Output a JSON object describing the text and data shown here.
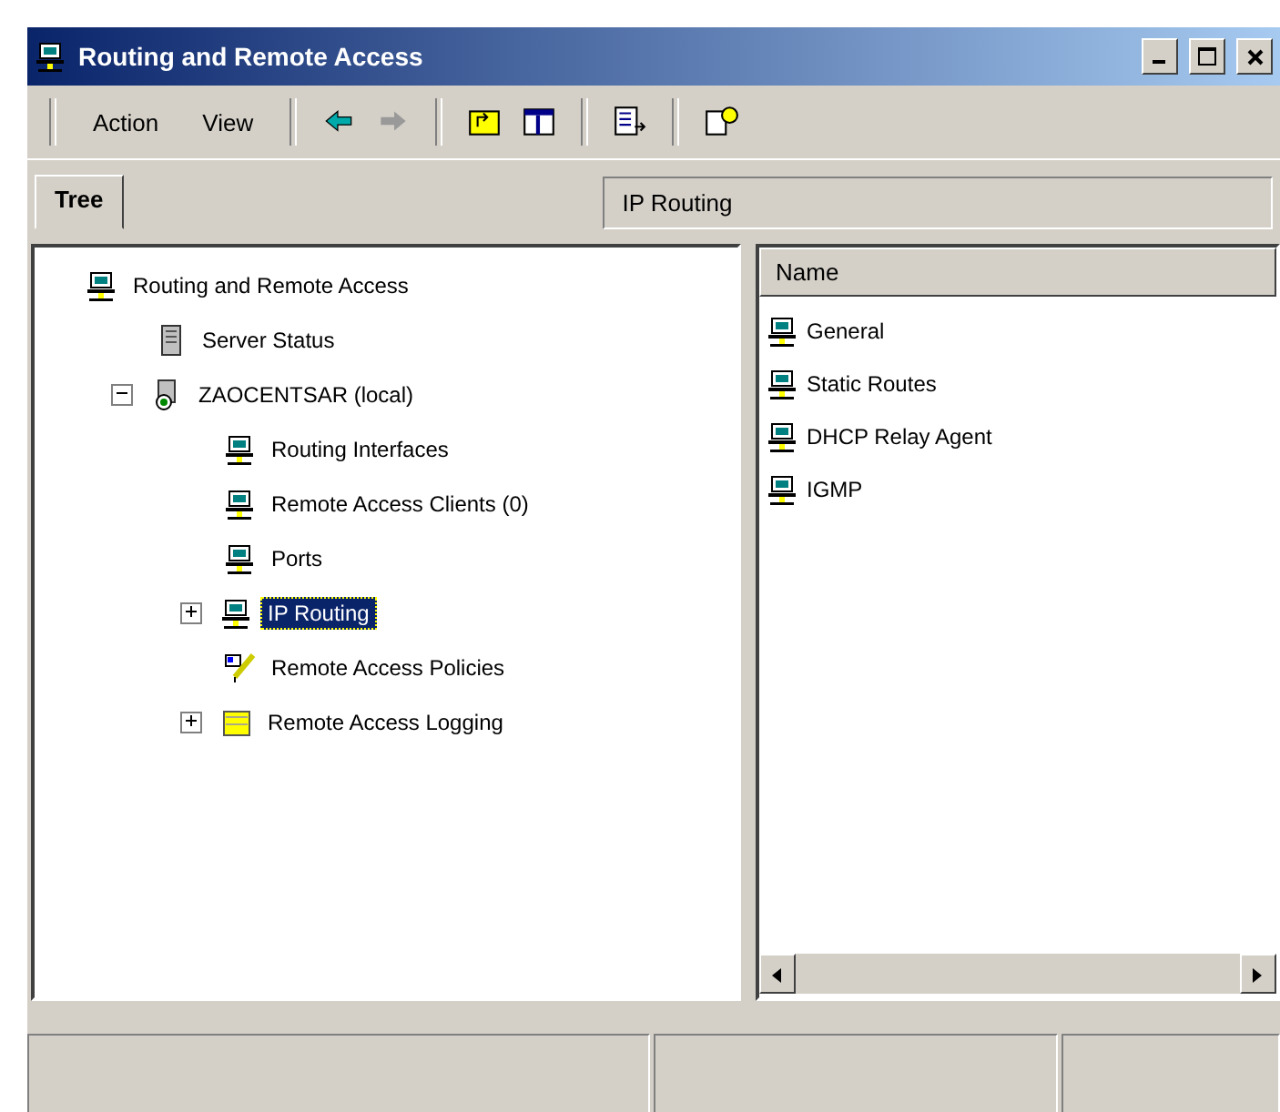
{
  "window": {
    "title": "Routing and Remote Access"
  },
  "menu": [
    {
      "label": "Action"
    },
    {
      "label": "View"
    }
  ],
  "toolbar": [
    {
      "kind": "back",
      "disabled": false
    },
    {
      "kind": "forward",
      "disabled": true
    },
    {
      "kind": "up"
    },
    {
      "kind": "show-tree"
    },
    {
      "kind": "export"
    },
    {
      "kind": "help"
    }
  ],
  "tabs": [
    {
      "label": "Tree",
      "selected": true
    }
  ],
  "tree": [
    {
      "label": "Routing and Remote Access",
      "kind": "computer",
      "selected": false,
      "children": [
        {
          "label": "Server Status",
          "kind": "server",
          "selected": false
        },
        {
          "label": "ZAOCENTSAR (local)",
          "kind": "local",
          "selected": false,
          "expanded": true,
          "children": [
            {
              "label": "Routing Interfaces",
              "kind": "computer",
              "selected": false
            },
            {
              "label": "Remote Access Clients (0)",
              "kind": "computer",
              "selected": false
            },
            {
              "label": "Ports",
              "kind": "computer",
              "selected": false
            },
            {
              "label": "IP Routing",
              "kind": "computer",
              "selected": true,
              "expanded": false
            },
            {
              "label": "Remote Access Policies",
              "kind": "policy",
              "selected": false
            },
            {
              "label": "Remote Access Logging",
              "kind": "log",
              "selected": false,
              "expanded": false
            }
          ]
        }
      ]
    }
  ],
  "detail": {
    "title": "IP Routing",
    "columns": [
      "Name"
    ],
    "rows": [
      {
        "name": "General"
      },
      {
        "name": "Static Routes"
      },
      {
        "name": "DHCP Relay Agent"
      },
      {
        "name": "IGMP"
      }
    ]
  }
}
